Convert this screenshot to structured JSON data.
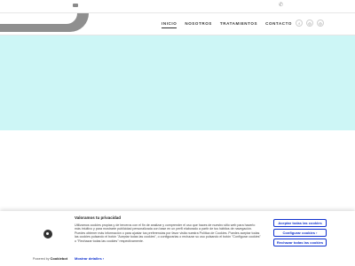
{
  "topbar": {
    "phone_icon": "phone-icon",
    "mail_icon": "mail-icon"
  },
  "nav": {
    "items": [
      "INICIO",
      "NOSOTROS",
      "TRATAMIENTOS",
      "CONTACTO"
    ]
  },
  "social": {
    "icons": [
      "f",
      "◎",
      "◎"
    ]
  },
  "hero": {
    "color": "#cdf6f6"
  },
  "cookie": {
    "title": "Valoramos tu privacidad",
    "text": "Utilizamos cookies propias y de terceros con el fin de analizar y comprender el uso que haces de nuestro sitio web para hacerlo más intuitivo y para mostrarte publicidad personalizada con base en un perfil elaborado a partir de tus hábitos de navegación. Puedes obtener más información o para ajustar tus preferencias por favor visita nuestra Política de Cookies. Puedes aceptar todas las cookies pulsando el botón \"Aceptar todas las cookies\", o configurarlas o rechazar su uso pulsando el botón \"Configurar cookies\" o \"Rechazar todas las cookies\" respectivamente.",
    "more": "Mostrar detalles  ›",
    "powered_by": "Powered by",
    "brand": "Cookiebot",
    "accept": "Aceptar todas las cookies",
    "configure": "Configurar cookies  ›",
    "reject": "Rechazar todas las cookies"
  }
}
